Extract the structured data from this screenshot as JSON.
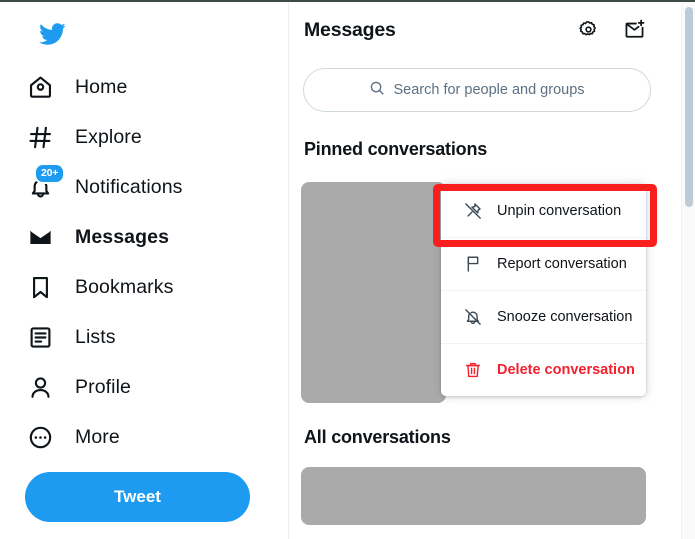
{
  "sidebar": {
    "logo_icon": "twitter-bird-icon",
    "items": [
      {
        "label": "Home",
        "icon": "home-icon",
        "active": false,
        "badge": ""
      },
      {
        "label": "Explore",
        "icon": "hashtag-icon",
        "active": false,
        "badge": ""
      },
      {
        "label": "Notifications",
        "icon": "bell-icon",
        "active": false,
        "badge": "20+"
      },
      {
        "label": "Messages",
        "icon": "envelope-icon",
        "active": true,
        "badge": ""
      },
      {
        "label": "Bookmarks",
        "icon": "bookmark-icon",
        "active": false,
        "badge": ""
      },
      {
        "label": "Lists",
        "icon": "list-icon",
        "active": false,
        "badge": ""
      },
      {
        "label": "Profile",
        "icon": "person-icon",
        "active": false,
        "badge": ""
      },
      {
        "label": "More",
        "icon": "more-circle-icon",
        "active": false,
        "badge": ""
      }
    ],
    "tweet_button_label": "Tweet"
  },
  "header": {
    "title": "Messages",
    "settings_icon": "gear-icon",
    "new_message_icon": "new-message-icon"
  },
  "search": {
    "placeholder": "Search for people and groups",
    "icon": "search-icon"
  },
  "sections": {
    "pinned_title": "Pinned conversations",
    "all_title": "All conversations"
  },
  "context_menu": {
    "items": [
      {
        "label": "Unpin conversation",
        "icon": "unpin-icon",
        "danger": false,
        "highlighted": true
      },
      {
        "label": "Report conversation",
        "icon": "flag-icon",
        "danger": false,
        "highlighted": false
      },
      {
        "label": "Snooze conversation",
        "icon": "bell-slash-icon",
        "danger": false,
        "highlighted": false
      },
      {
        "label": "Delete conversation",
        "icon": "trash-icon",
        "danger": true,
        "highlighted": false
      }
    ]
  },
  "colors": {
    "brand_blue": "#1d9bf0",
    "danger_red": "#f4212e",
    "highlight_red": "#fa1e1e",
    "placeholder_gray": "#aaaaaa",
    "text_primary": "#0f1419",
    "text_muted": "#5b7083"
  }
}
